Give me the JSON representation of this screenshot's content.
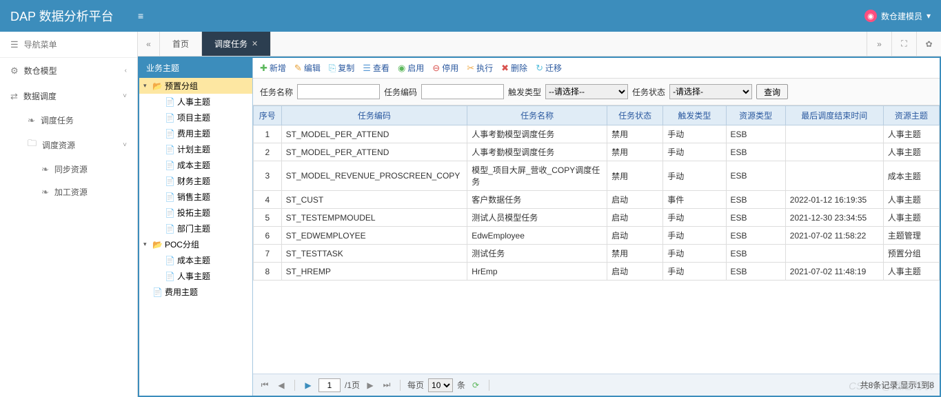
{
  "header": {
    "logo": "DAP 数据分析平台",
    "user": "数仓建模员",
    "chevron": "▾"
  },
  "sidebar": {
    "nav_title": "导航菜单",
    "items": [
      {
        "icon": "⚙",
        "label": "数仓模型"
      },
      {
        "icon": "⇄",
        "label": "数据调度"
      }
    ],
    "subs": [
      {
        "label": "调度任务"
      },
      {
        "label": "调度资源"
      }
    ],
    "subsubs": [
      {
        "label": "同步资源"
      },
      {
        "label": "加工资源"
      }
    ]
  },
  "tabs": {
    "home": "首页",
    "active": "调度任务"
  },
  "tree": {
    "title": "业务主题",
    "root": "预置分组",
    "root_children": [
      "人事主题",
      "项目主题",
      "费用主题",
      "计划主题",
      "成本主题",
      "财务主题",
      "销售主题",
      "投拓主题",
      "部门主题"
    ],
    "poc": "POC分组",
    "poc_children": [
      "成本主题",
      "人事主题"
    ],
    "extra": "费用主题"
  },
  "toolbar": {
    "add": "新增",
    "edit": "编辑",
    "copy": "复制",
    "view": "查看",
    "enable": "启用",
    "disable": "停用",
    "exec": "执行",
    "del": "删除",
    "mig": "迁移"
  },
  "filters": {
    "name_label": "任务名称",
    "code_label": "任务编码",
    "trigger_label": "触发类型",
    "trigger_placeholder": "--请选择--",
    "status_label": "任务状态",
    "status_placeholder": "-请选择-",
    "query": "查询"
  },
  "columns": [
    "序号",
    "任务编码",
    "任务名称",
    "任务状态",
    "触发类型",
    "资源类型",
    "最后调度结束时间",
    "资源主题"
  ],
  "rows": [
    {
      "no": "1",
      "code": "ST_MODEL_PER_ATTEND",
      "name": "人事考勤模型调度任务",
      "status": "禁用",
      "trigger": "手动",
      "res": "ESB",
      "time": "",
      "topic": "人事主题"
    },
    {
      "no": "2",
      "code": "ST_MODEL_PER_ATTEND",
      "name": "人事考勤模型调度任务",
      "status": "禁用",
      "trigger": "手动",
      "res": "ESB",
      "time": "",
      "topic": "人事主题"
    },
    {
      "no": "3",
      "code": "ST_MODEL_REVENUE_PROSCREEN_COPY",
      "name": "模型_项目大屏_营收_COPY调度任务",
      "status": "禁用",
      "trigger": "手动",
      "res": "ESB",
      "time": "",
      "topic": "成本主题"
    },
    {
      "no": "4",
      "code": "ST_CUST",
      "name": "客户数据任务",
      "status": "启动",
      "trigger": "事件",
      "res": "ESB",
      "time": "2022-01-12 16:19:35",
      "topic": "人事主题"
    },
    {
      "no": "5",
      "code": "ST_TESTEMPMOUDEL",
      "name": "测试人员模型任务",
      "status": "启动",
      "trigger": "手动",
      "res": "ESB",
      "time": "2021-12-30 23:34:55",
      "topic": "人事主题"
    },
    {
      "no": "6",
      "code": "ST_EDWEMPLOYEE",
      "name": "EdwEmployee",
      "status": "启动",
      "trigger": "手动",
      "res": "ESB",
      "time": "2021-07-02 11:58:22",
      "topic": "主题管理"
    },
    {
      "no": "7",
      "code": "ST_TESTTASK",
      "name": "测试任务",
      "status": "禁用",
      "trigger": "手动",
      "res": "ESB",
      "time": "",
      "topic": "预置分组"
    },
    {
      "no": "8",
      "code": "ST_HREMP",
      "name": "HrEmp",
      "status": "启动",
      "trigger": "手动",
      "res": "ESB",
      "time": "2021-07-02 11:48:19",
      "topic": "人事主题"
    }
  ],
  "pager": {
    "page": "1",
    "total_pages": "/1页",
    "per_page_label": "每页",
    "per_page": "10",
    "unit": "条",
    "info": "共8条记录,显示1到8"
  },
  "watermark": "CSDN @数通畅联"
}
